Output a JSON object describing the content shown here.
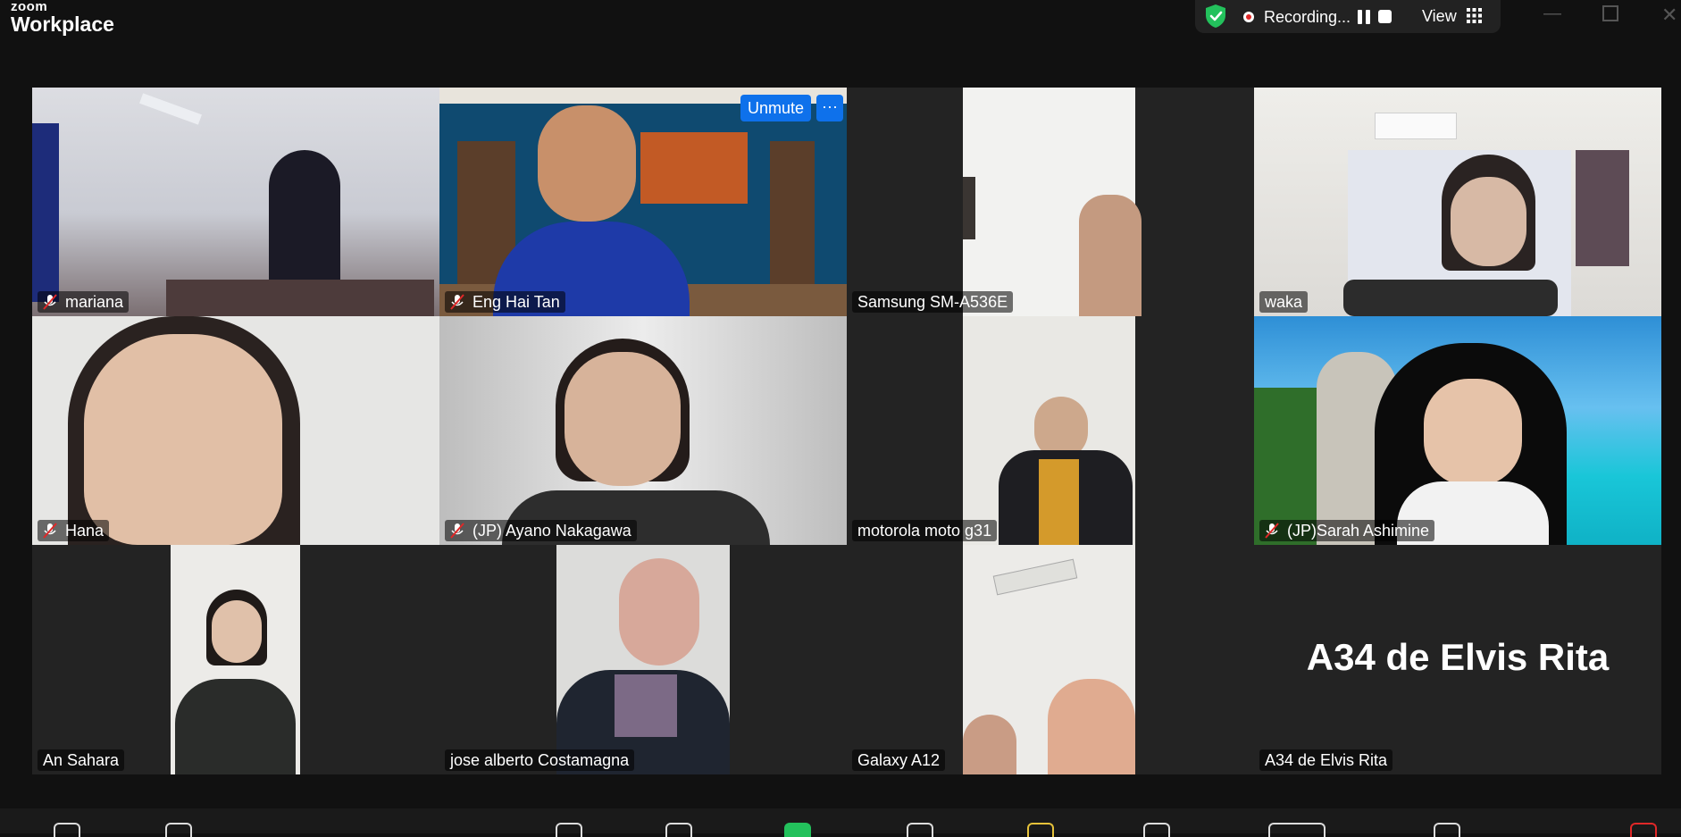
{
  "app": {
    "logo_line1": "zoom",
    "logo_line2": "Workplace"
  },
  "recording": {
    "label": "Recording...",
    "view_label": "View"
  },
  "colors": {
    "active_speaker_border": "#2ee07a",
    "accent_blue": "#0e71eb",
    "tile_bg": "#232323"
  },
  "tiles": [
    {
      "name": "mariana",
      "muted": true
    },
    {
      "name": "Eng Hai Tan",
      "muted": true,
      "unmute_label": "Unmute",
      "more_label": "···"
    },
    {
      "name": "Samsung SM-A536E",
      "muted": false
    },
    {
      "name": "waka",
      "muted": false,
      "active_speaker": true
    },
    {
      "name": "Hana",
      "muted": true
    },
    {
      "name": "(JP) Ayano Nakagawa",
      "muted": true
    },
    {
      "name": "motorola moto g31",
      "muted": false
    },
    {
      "name": "(JP)Sarah Ashimine",
      "muted": true
    },
    {
      "name": "An Sahara",
      "muted": false
    },
    {
      "name": "jose alberto Costamagna",
      "muted": false
    },
    {
      "name": "Galaxy A12",
      "muted": false
    },
    {
      "name": "A34 de Elvis Rita",
      "muted": false,
      "video_off_label": "A34 de Elvis Rita"
    }
  ]
}
